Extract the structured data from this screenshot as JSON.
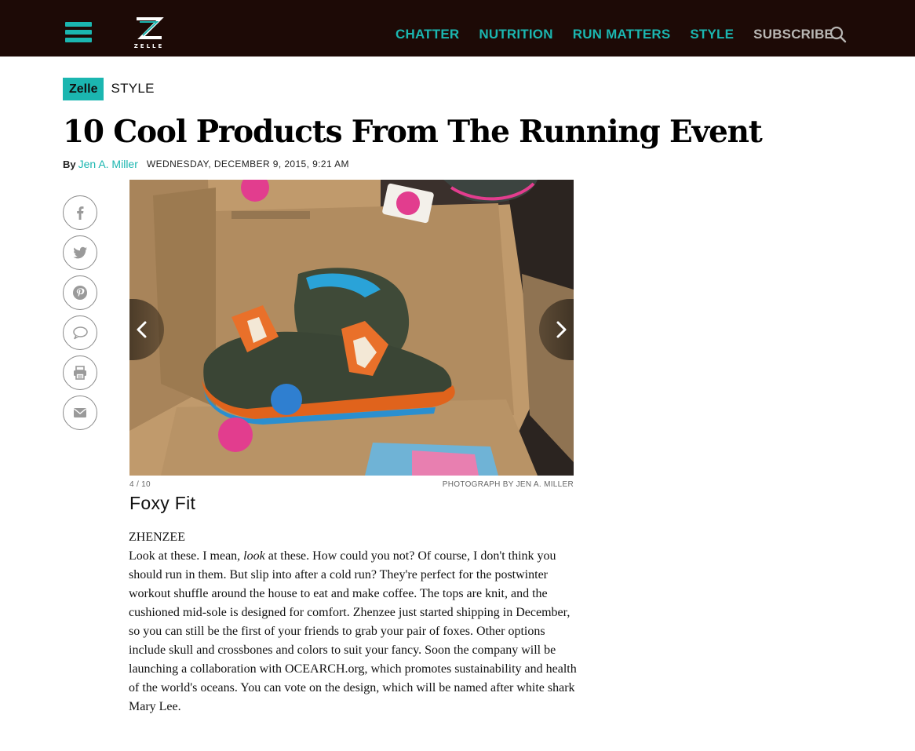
{
  "header": {
    "logo_text": "ZELLE",
    "nav": [
      "CHATTER",
      "NUTRITION",
      "RUN MATTERS",
      "STYLE"
    ],
    "subscribe": "SUBSCRIBE",
    "accent": "#1bb6b0",
    "bar_bg": "#1d0a06"
  },
  "article": {
    "brand": "Zelle",
    "section": "STYLE",
    "title": "10 Cool Products From The Running Event",
    "by": "By",
    "author": "Jen A. Miller",
    "date": "WEDNESDAY, DECEMBER 9, 2015, 9:21 AM"
  },
  "share": [
    "facebook-icon",
    "twitter-icon",
    "pinterest-icon",
    "comment-icon",
    "print-icon",
    "email-icon"
  ],
  "gallery": {
    "counter": "4 / 10",
    "credit": "PHOTOGRAPH BY JEN A. MILLER",
    "slide_title": "Foxy Fit",
    "brand_name": "ZHENZEE",
    "body_pre": "Look at these. I mean, ",
    "body_em": "look",
    "body_post": " at these. How could you not? Of course, I don't think you should run in them. But slip into after a cold run? They're perfect for the postwinter workout shuffle around the house to eat and make coffee. The tops are knit, and the cushioned mid-sole is designed for comfort. Zhenzee just started shipping in December, so you can still be the first of your friends to grab your pair of foxes. Other options include skull and crossbones and colors to suit your fancy. Soon the company will be launching a collaboration with OCEARCH.org, which promotes sustainability and health of the world's oceans. You can vote on the design, which will be named after white shark Mary Lee."
  }
}
